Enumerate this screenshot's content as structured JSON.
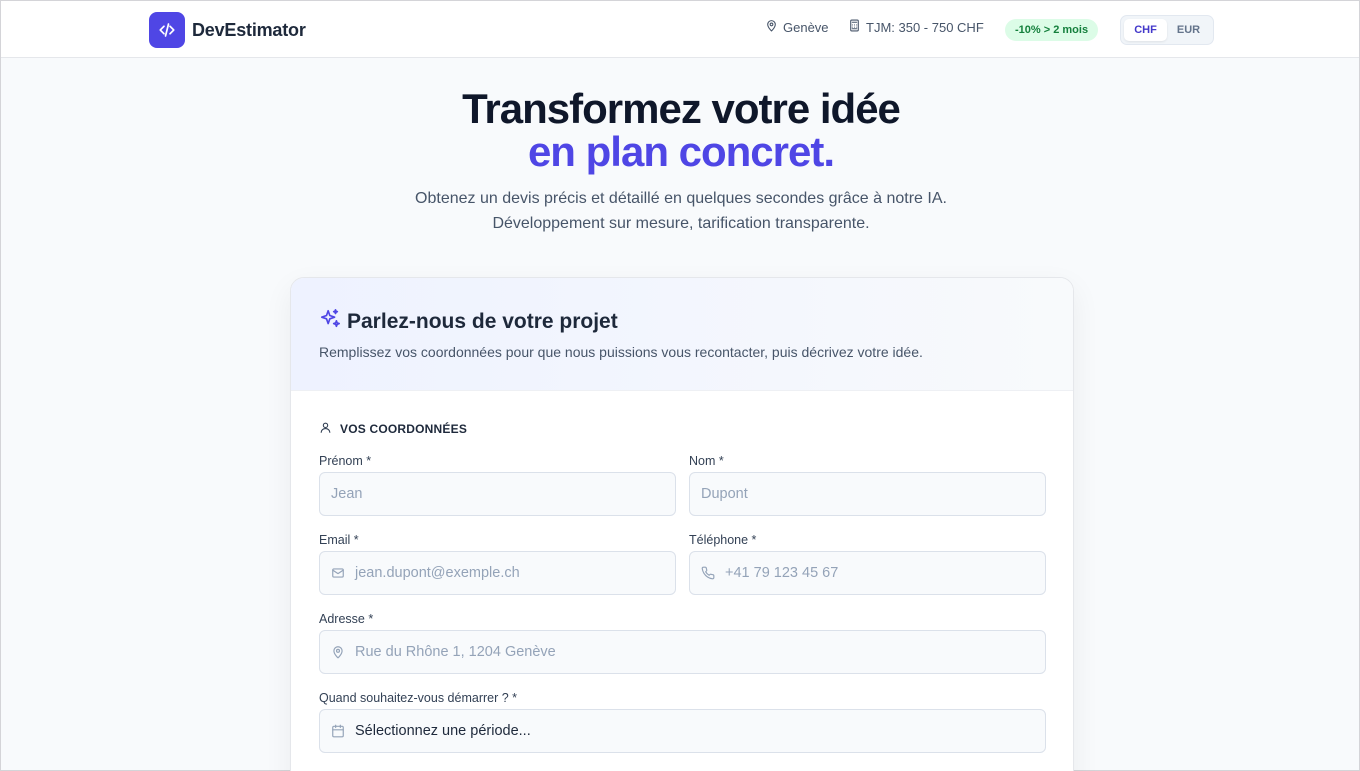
{
  "header": {
    "brand": "DevEstimator",
    "location": "Genève",
    "tjm": "TJM: 350 - 750 CHF",
    "discount_badge": "-10% > 2 mois",
    "currency_options": [
      "CHF",
      "EUR"
    ],
    "currency_selected": "CHF"
  },
  "hero": {
    "title_line1": "Transformez votre idée",
    "title_line2": "en plan concret.",
    "subtitle_line1": "Obtenez un devis précis et détaillé en quelques secondes grâce à notre IA.",
    "subtitle_line2": "Développement sur mesure, tarification transparente."
  },
  "form": {
    "title": "Parlez-nous de votre projet",
    "description": "Remplissez vos coordonnées pour que nous puissions vous recontacter, puis décrivez votre idée.",
    "section_contact": "VOS COORDONNÉES",
    "fields": {
      "first_name": {
        "label": "Prénom *",
        "placeholder": "Jean"
      },
      "last_name": {
        "label": "Nom *",
        "placeholder": "Dupont"
      },
      "email": {
        "label": "Email *",
        "placeholder": "jean.dupont@exemple.ch"
      },
      "phone": {
        "label": "Téléphone *",
        "placeholder": "+41 79 123 45 67"
      },
      "address": {
        "label": "Adresse *",
        "placeholder": "Rue du Rhône 1, 1204 Genève"
      },
      "start": {
        "label": "Quand souhaitez-vous démarrer ? *",
        "value": "Sélectionnez une période..."
      }
    }
  },
  "colors": {
    "accent": "#4f46e5",
    "badge_bg": "#dcfce7",
    "badge_text": "#15803d"
  },
  "icons": [
    "code-icon",
    "map-pin-icon",
    "calculator-icon",
    "sparkles-icon",
    "user-icon",
    "mail-icon",
    "phone-icon",
    "calendar-icon"
  ]
}
